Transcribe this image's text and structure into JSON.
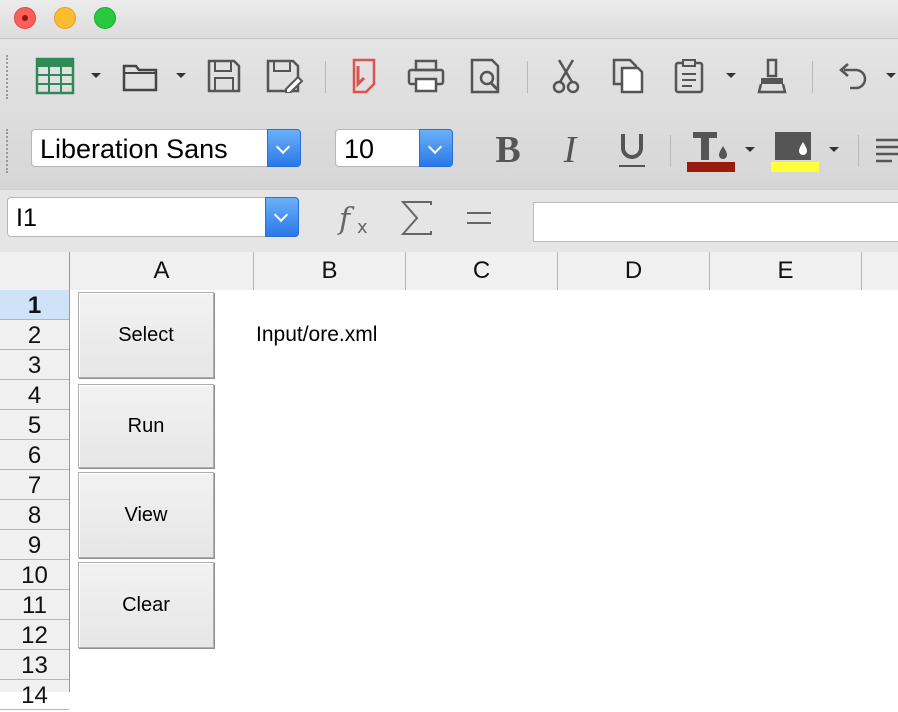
{
  "window": {
    "traffic_lights": {
      "close_color": "#fc5f57",
      "minimize_color": "#fdbc2e",
      "maximize_color": "#28c840"
    }
  },
  "toolbar": {
    "standard_icons": [
      "table-icon",
      "open-folder-icon",
      "save-icon",
      "save-as-icon",
      "export-pdf-icon",
      "print-icon",
      "print-preview-icon",
      "cut-icon",
      "copy-icon",
      "paste-icon",
      "clone-formatting-icon",
      "undo-icon"
    ],
    "font_name": "Liberation Sans",
    "font_size": "10",
    "format_icons": [
      "bold-icon",
      "italic-icon",
      "underline-icon",
      "font-color-icon",
      "highlight-color-icon",
      "align-left-icon"
    ],
    "font_color": "#9b1a10",
    "highlight_color": "#ffff3a"
  },
  "formula_bar": {
    "name_box": "I1",
    "function_wizard_icon": "fx-icon",
    "sum_icon": "sigma-icon",
    "formula_icon": "equals-icon",
    "formula_value": ""
  },
  "grid": {
    "columns": [
      "A",
      "B",
      "C",
      "D",
      "E"
    ],
    "rows": [
      "1",
      "2",
      "3",
      "4",
      "5",
      "6",
      "7",
      "8",
      "9",
      "10",
      "11",
      "12",
      "13",
      "14"
    ],
    "selected_row": "1",
    "cells": {
      "B2": "Input/ore.xml"
    }
  },
  "form_buttons": [
    "Select",
    "Run",
    "View",
    "Clear"
  ]
}
